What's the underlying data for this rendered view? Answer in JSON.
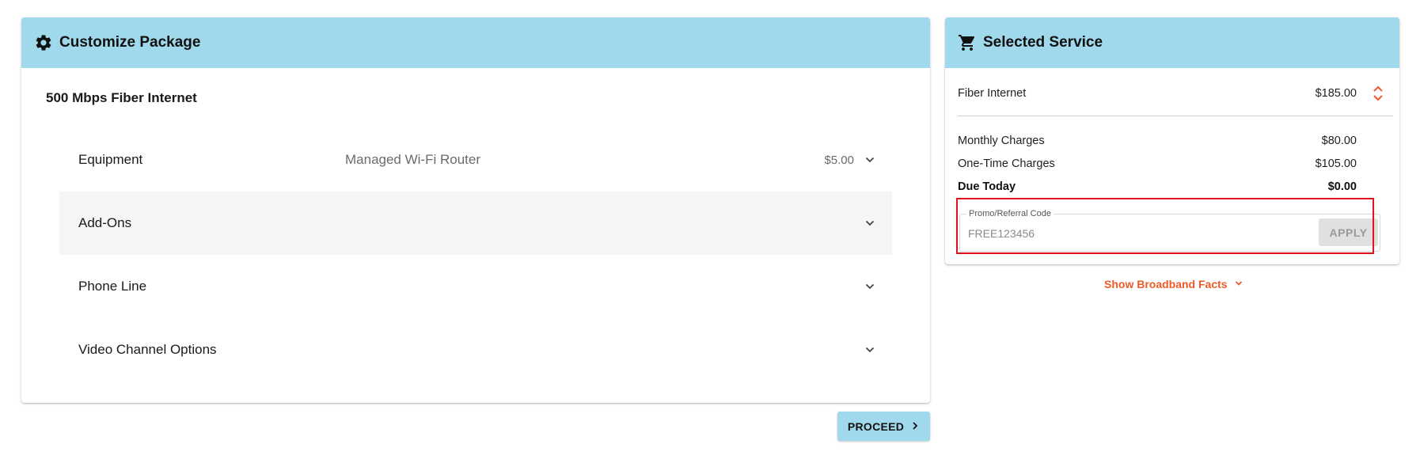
{
  "customize": {
    "header_title": "Customize Package",
    "header_icon": "gear-icon",
    "package_name": "500 Mbps Fiber Internet",
    "rows": [
      {
        "label": "Equipment",
        "value": "Managed Wi-Fi Router",
        "price": "$5.00"
      },
      {
        "label": "Add-Ons",
        "value": "",
        "price": ""
      },
      {
        "label": "Phone Line",
        "value": "",
        "price": ""
      },
      {
        "label": "Video Channel Options",
        "value": "",
        "price": ""
      }
    ],
    "proceed_label": "PROCEED"
  },
  "service": {
    "header_title": "Selected Service",
    "header_icon": "cart-icon",
    "item": {
      "label": "Fiber Internet",
      "price": "$185.00"
    },
    "monthly": {
      "label": "Monthly Charges",
      "value": "$80.00"
    },
    "one_time": {
      "label": "One-Time Charges",
      "value": "$105.00"
    },
    "due_today": {
      "label": "Due Today",
      "value": "$0.00"
    },
    "promo": {
      "legend": "Promo/Referral Code",
      "placeholder": "FREE123456",
      "apply_label": "APPLY"
    }
  },
  "broadband_link": "Show Broadband Facts",
  "colors": {
    "header_bg": "#a0d9eb",
    "accent_orange": "#f05a28",
    "highlight_red": "#e0141e"
  }
}
